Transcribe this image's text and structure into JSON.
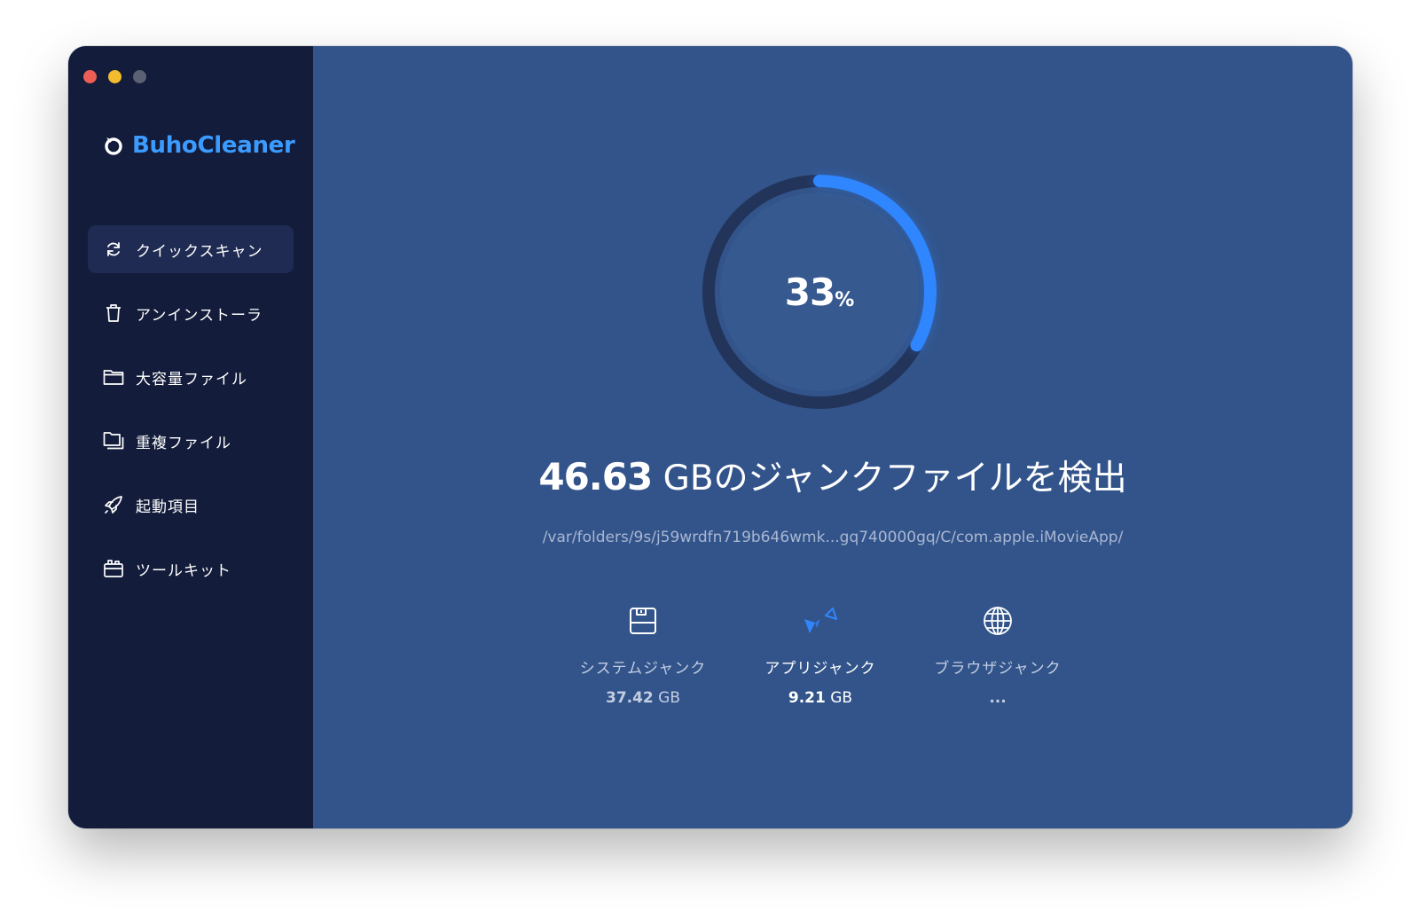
{
  "app": {
    "name": "BuhoCleaner"
  },
  "sidebar": {
    "items": [
      {
        "label": "クイックスキャン",
        "icon": "refresh-icon",
        "active": true
      },
      {
        "label": "アンインストーラ",
        "icon": "trash-icon"
      },
      {
        "label": "大容量ファイル",
        "icon": "folder-icon"
      },
      {
        "label": "重複ファイル",
        "icon": "duplicate-folder-icon"
      },
      {
        "label": "起動項目",
        "icon": "rocket-icon"
      },
      {
        "label": "ツールキット",
        "icon": "toolkit-icon"
      }
    ]
  },
  "scan": {
    "progress_percent": 33,
    "progress_number": "33",
    "progress_unit": "%",
    "found_size": "46.63",
    "found_text": " GBのジャンクファイルを検出",
    "current_path": "/var/folders/9s/j59wrdfn719b646wmk...gq740000gq/C/com.apple.iMovieApp/",
    "accent_color": "#2f86ff"
  },
  "categories": [
    {
      "label": "システムジャンク",
      "value": "37.42",
      "unit": " GB",
      "icon": "disk-icon"
    },
    {
      "label": "アプリジャンク",
      "value": "9.21",
      "unit": " GB",
      "icon": "app-icon"
    },
    {
      "label": "ブラウザジャンク",
      "value": "...",
      "unit": "",
      "icon": "globe-icon"
    }
  ]
}
